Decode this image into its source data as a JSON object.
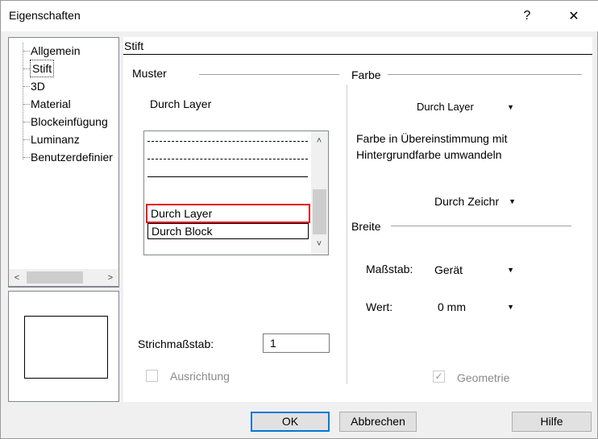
{
  "window": {
    "title": "Eigenschaften",
    "help_glyph": "?",
    "close_glyph": "✕"
  },
  "tree": {
    "items": [
      "Allgemein",
      "Stift",
      "3D",
      "Material",
      "Blockeinfügung",
      "Luminanz",
      "Benutzerdefinier"
    ],
    "selected": "Stift",
    "scroll_left": "<",
    "scroll_right": ">"
  },
  "panel": {
    "title": "Stift"
  },
  "muster": {
    "label": "Muster",
    "current": "Durch Layer",
    "list_items": [
      "Durch Layer",
      "Durch Block"
    ],
    "scroll_up": "˄",
    "scroll_down": "˅"
  },
  "strich": {
    "label": "Strichmaßstab:",
    "value": "1"
  },
  "ausrichtung": {
    "label": "Ausrichtung",
    "checked": false
  },
  "farbe": {
    "label": "Farbe",
    "dropdown_value": "Durch Layer",
    "convert_text_line1": "Farbe in Übereinstimmung mit",
    "convert_text_line2": "Hintergrundfarbe umwandeln",
    "convert_dropdown_value": "Durch Zeichr"
  },
  "breite": {
    "label": "Breite",
    "massstab_label": "Maßstab:",
    "massstab_value": "Gerät",
    "wert_label": "Wert:",
    "wert_value": "0 mm"
  },
  "geometrie": {
    "label": "Geometrie",
    "checked": true
  },
  "buttons": {
    "ok": "OK",
    "cancel": "Abbrechen",
    "help": "Hilfe"
  },
  "colors": {
    "accent": "#0078d7",
    "selection_outline": "#e81123"
  },
  "icons": {
    "dropdown": "chevron-down-icon",
    "check": "check-icon"
  }
}
